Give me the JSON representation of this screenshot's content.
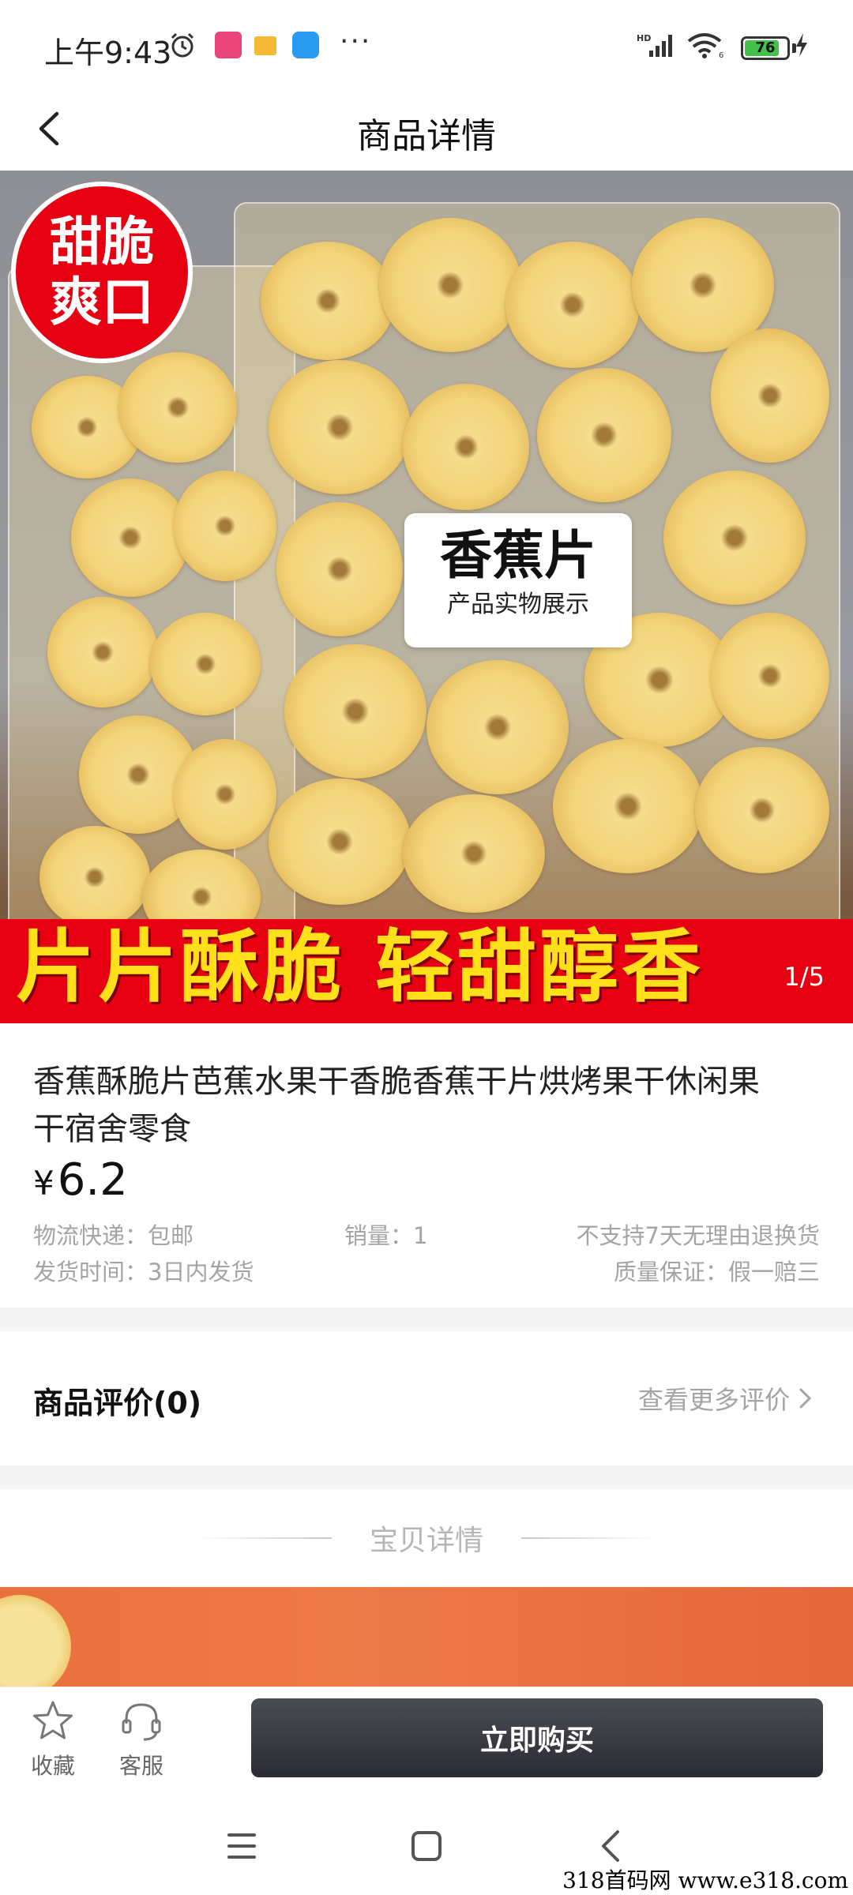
{
  "status_bar": {
    "time": "上午9:43",
    "battery": "76",
    "battery_level": 0.76,
    "more_icon": "···"
  },
  "nav": {
    "title": "商品详情"
  },
  "hero": {
    "badge_line1": "甜脆",
    "badge_line2": "爽口",
    "label_main": "香蕉片",
    "label_sub": "产品实物展示",
    "banner": "片片酥脆  轻甜醇香",
    "pager": "1/5"
  },
  "product": {
    "title": "香蕉酥脆片芭蕉水果干香脆香蕉干片烘烤果干休闲果干宿舍零食",
    "currency": "¥",
    "price": "6.2",
    "shipping": "物流快递：包邮",
    "sales": "销量：1",
    "return_policy": "不支持7天无理由退换货",
    "ship_time": "发货时间：3日内发货",
    "guarantee": "质量保证：假一赔三"
  },
  "reviews": {
    "title": "商品评价(0)",
    "more": "查看更多评价"
  },
  "details": {
    "title": "宝贝详情"
  },
  "actions": {
    "favorite": "收藏",
    "service": "客服",
    "buy": "立即购买"
  },
  "watermark": "318首码网  www.e318.com",
  "colors": {
    "badge_red": "#e60012",
    "banner_yellow": "#ffe01a",
    "buy_button": "#2b2c33",
    "muted_text": "#a4a4a4"
  }
}
